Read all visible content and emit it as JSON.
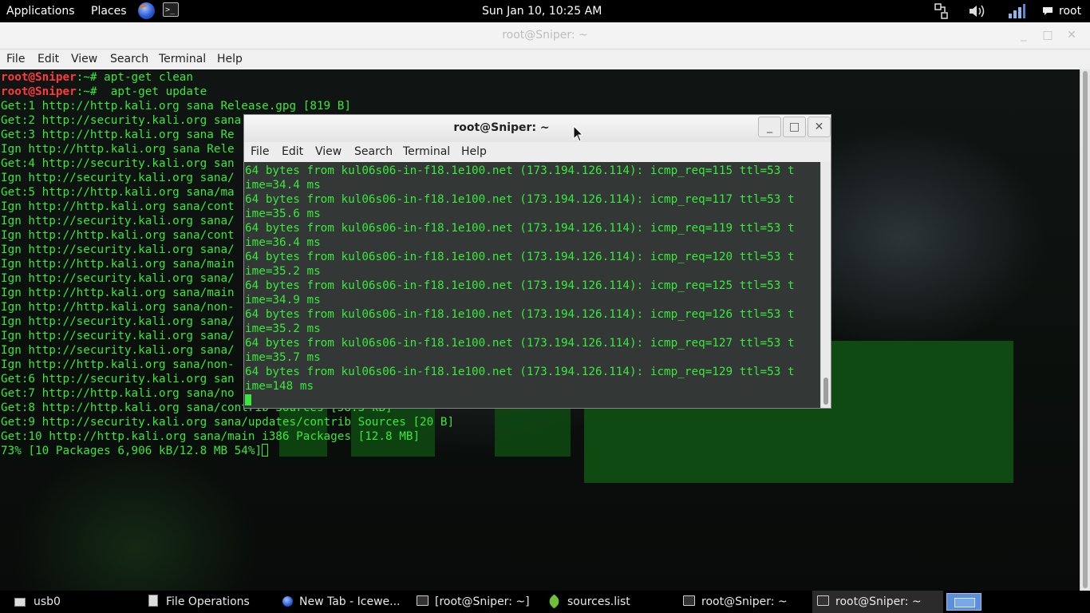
{
  "top_panel": {
    "applications": "Applications",
    "places": "Places",
    "clock": "Sun Jan 10, 10:25 AM",
    "user": "root",
    "icons": [
      "iceweasel-icon",
      "terminal-icon",
      "network-icon",
      "volume-icon",
      "signal-icon",
      "chat-icon"
    ]
  },
  "main_window": {
    "title": "root@Sniper: ~",
    "buttons": {
      "minimize": "_",
      "maximize": "□",
      "close": "✕"
    },
    "menu": [
      "File",
      "Edit",
      "View",
      "Search",
      "Terminal",
      "Help"
    ],
    "lines": [
      {
        "prompt": "root@Sniper",
        "text": ":~# apt-get clean"
      },
      {
        "prompt": "root@Sniper",
        "text": ":~#  apt-get update"
      },
      {
        "text": "Get:1 http://http.kali.org sana Release.gpg [819 B]"
      },
      {
        "text": "Get:2 http://security.kali.org sana"
      },
      {
        "text": "Get:3 http://http.kali.org sana Re"
      },
      {
        "text": "Ign http://http.kali.org sana Rele"
      },
      {
        "text": "Get:4 http://security.kali.org san"
      },
      {
        "text": "Ign http://security.kali.org sana/"
      },
      {
        "text": "Get:5 http://http.kali.org sana/ma"
      },
      {
        "text": "Ign http://http.kali.org sana/cont"
      },
      {
        "text": "Ign http://security.kali.org sana/"
      },
      {
        "text": "Ign http://http.kali.org sana/cont"
      },
      {
        "text": "Ign http://security.kali.org sana/"
      },
      {
        "text": "Ign http://http.kali.org sana/main"
      },
      {
        "text": "Ign http://security.kali.org sana/"
      },
      {
        "text": "Ign http://http.kali.org sana/main"
      },
      {
        "text": "Ign http://http.kali.org sana/non-"
      },
      {
        "text": "Ign http://security.kali.org sana/"
      },
      {
        "text": "Ign http://security.kali.org sana/"
      },
      {
        "text": "Ign http://security.kali.org sana/"
      },
      {
        "text": "Ign http://http.kali.org sana/non-"
      },
      {
        "text": "Get:6 http://security.kali.org san"
      },
      {
        "text": "Get:7 http://http.kali.org sana/no"
      },
      {
        "text": "Get:8 http://http.kali.org sana/contrib Sources [58.3 kB]"
      },
      {
        "text": "Get:9 http://security.kali.org sana/updates/contrib Sources [20 B]"
      },
      {
        "text": "Get:10 http://http.kali.org sana/main i386 Packages [12.8 MB]"
      },
      {
        "text": "73% [10 Packages 6,906 kB/12.8 MB 54%]",
        "cursor": true
      }
    ]
  },
  "second_window": {
    "title": "root@Sniper: ~",
    "buttons": {
      "minimize": "_",
      "maximize": "□",
      "close": "✕"
    },
    "menu": [
      "File",
      "Edit",
      "View",
      "Search",
      "Terminal",
      "Help"
    ],
    "lines": [
      "64 bytes from kul06s06-in-f18.1e100.net (173.194.126.114): icmp_req=115 ttl=53 t",
      "ime=34.4 ms",
      "64 bytes from kul06s06-in-f18.1e100.net (173.194.126.114): icmp_req=117 ttl=53 t",
      "ime=35.6 ms",
      "64 bytes from kul06s06-in-f18.1e100.net (173.194.126.114): icmp_req=119 ttl=53 t",
      "ime=36.4 ms",
      "64 bytes from kul06s06-in-f18.1e100.net (173.194.126.114): icmp_req=120 ttl=53 t",
      "ime=35.2 ms",
      "64 bytes from kul06s06-in-f18.1e100.net (173.194.126.114): icmp_req=125 ttl=53 t",
      "ime=34.9 ms",
      "64 bytes from kul06s06-in-f18.1e100.net (173.194.126.114): icmp_req=126 ttl=53 t",
      "ime=35.2 ms",
      "64 bytes from kul06s06-in-f18.1e100.net (173.194.126.114): icmp_req=127 ttl=53 t",
      "ime=35.7 ms",
      "64 bytes from kul06s06-in-f18.1e100.net (173.194.126.114): icmp_req=129 ttl=53 t",
      "ime=148 ms"
    ]
  },
  "taskbar": {
    "items": [
      {
        "label": "usb0",
        "icon": "drive-icon"
      },
      {
        "label": "File Operations",
        "icon": "file-icon"
      },
      {
        "label": "New Tab - Icewe...",
        "icon": "iceweasel-icon"
      },
      {
        "label": "[root@Sniper: ~]",
        "icon": "terminal-icon"
      },
      {
        "label": "sources.list",
        "icon": "text-editor-icon"
      },
      {
        "label": "root@Sniper: ~",
        "icon": "terminal-icon"
      },
      {
        "label": "root@Sniper: ~",
        "icon": "terminal-icon",
        "active": true
      }
    ]
  },
  "colors": {
    "terminal_green": "#39e83b",
    "prompt_red": "#ff3a3a",
    "wallpaper_green": "#0f4a12"
  }
}
